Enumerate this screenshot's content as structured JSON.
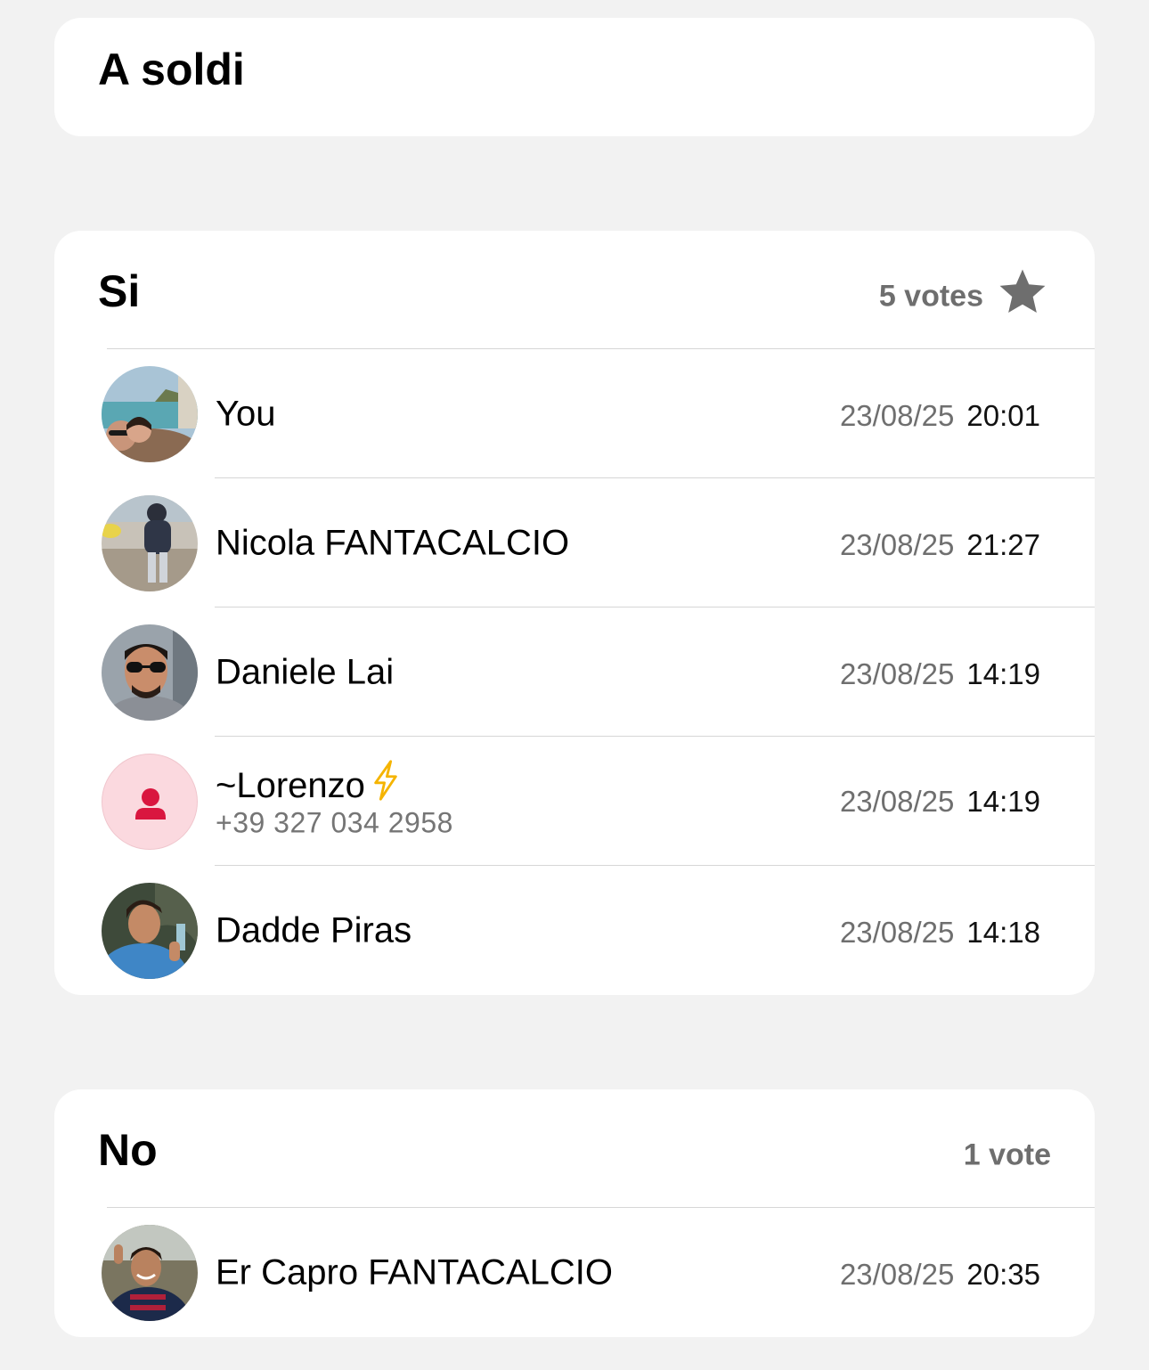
{
  "poll": {
    "question": "A soldi"
  },
  "options": [
    {
      "title": "Si",
      "votes": "5 votes",
      "winner_icon": "star-icon",
      "voters": [
        {
          "name": "You",
          "date": "23/08/25",
          "time": "20:01",
          "avatar": "photo"
        },
        {
          "name": "Nicola FANTACALCIO",
          "date": "23/08/25",
          "time": "21:27",
          "avatar": "photo"
        },
        {
          "name": "Daniele Lai",
          "date": "23/08/25",
          "time": "14:19",
          "avatar": "photo"
        },
        {
          "name": "~Lorenzo",
          "name_icon": "lightning-bolt-icon",
          "subtitle": "+39 327 034 2958",
          "date": "23/08/25",
          "time": "14:19",
          "avatar": "person-placeholder-icon"
        },
        {
          "name": "Dadde Piras",
          "date": "23/08/25",
          "time": "14:18",
          "avatar": "photo"
        }
      ]
    },
    {
      "title": "No",
      "votes": "1 vote",
      "voters": [
        {
          "name": "Er Capro FANTACALCIO",
          "date": "23/08/25",
          "time": "20:35",
          "avatar": "photo"
        }
      ]
    }
  ],
  "colors": {
    "background": "#f2f2f2",
    "card": "#ffffff",
    "muted_text": "#6e6e6e",
    "placeholder_avatar_bg": "#fbd9df",
    "placeholder_avatar_icon": "#d9163f",
    "bolt": "#f5b400"
  }
}
